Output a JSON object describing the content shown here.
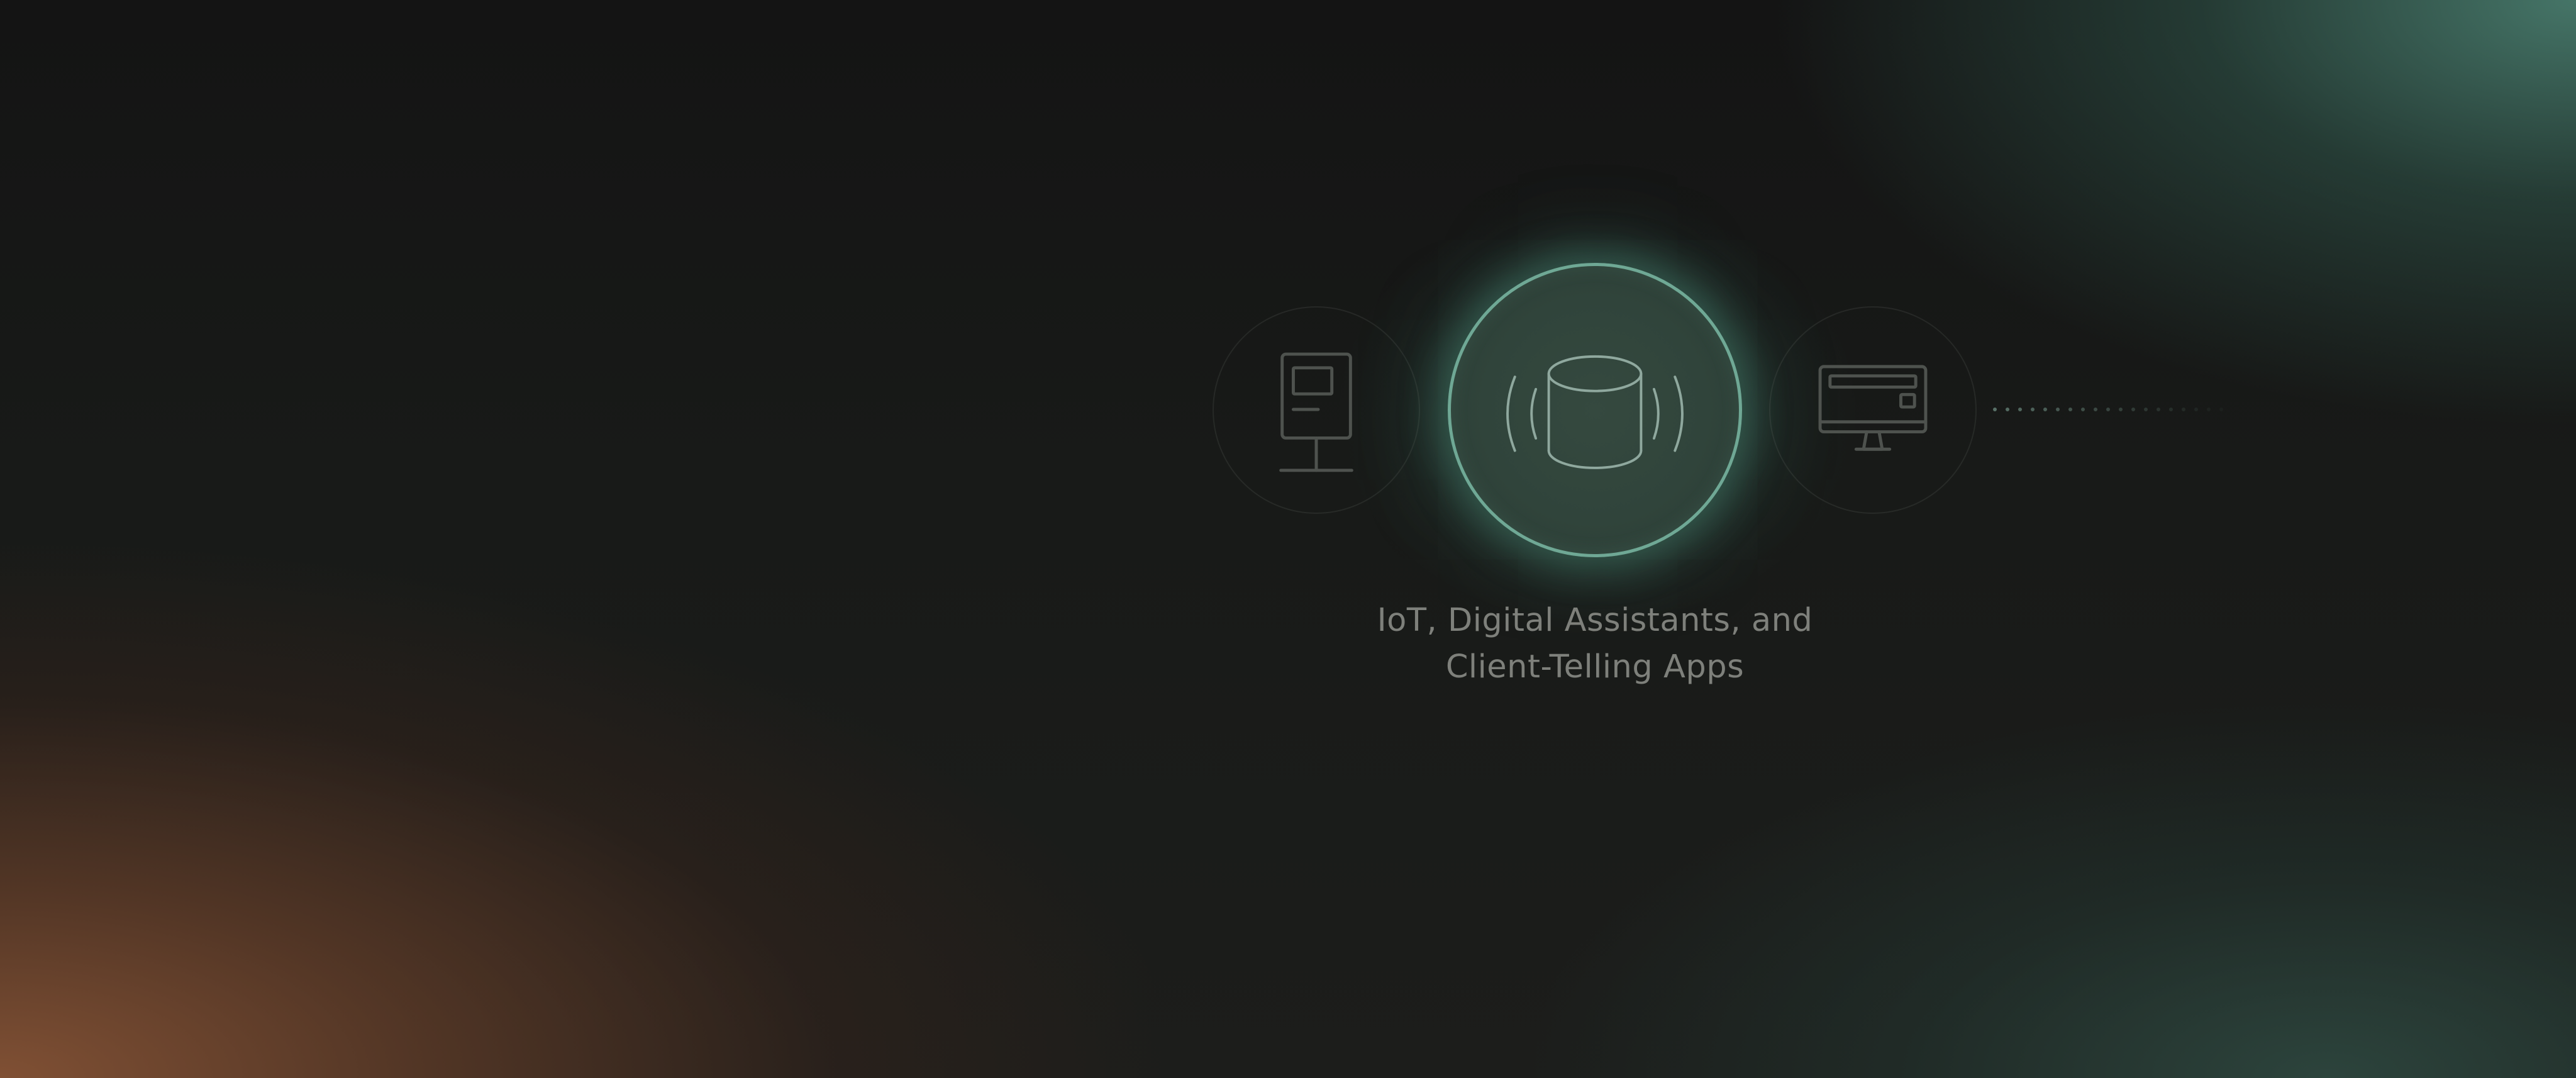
{
  "caption": {
    "line1": "IoT, Digital Assistants, and",
    "line2": "Client-Telling Apps"
  },
  "nodes": [
    {
      "name": "kiosk",
      "icon": "kiosk-icon",
      "state": "inactive"
    },
    {
      "name": "smart-speaker",
      "icon": "smart-speaker-icon",
      "state": "active"
    },
    {
      "name": "desktop",
      "icon": "desktop-monitor-icon",
      "state": "inactive"
    }
  ],
  "colors": {
    "accent": "#6fa895",
    "caption": "#7e807b",
    "inactive_icon": "#4e524e"
  }
}
